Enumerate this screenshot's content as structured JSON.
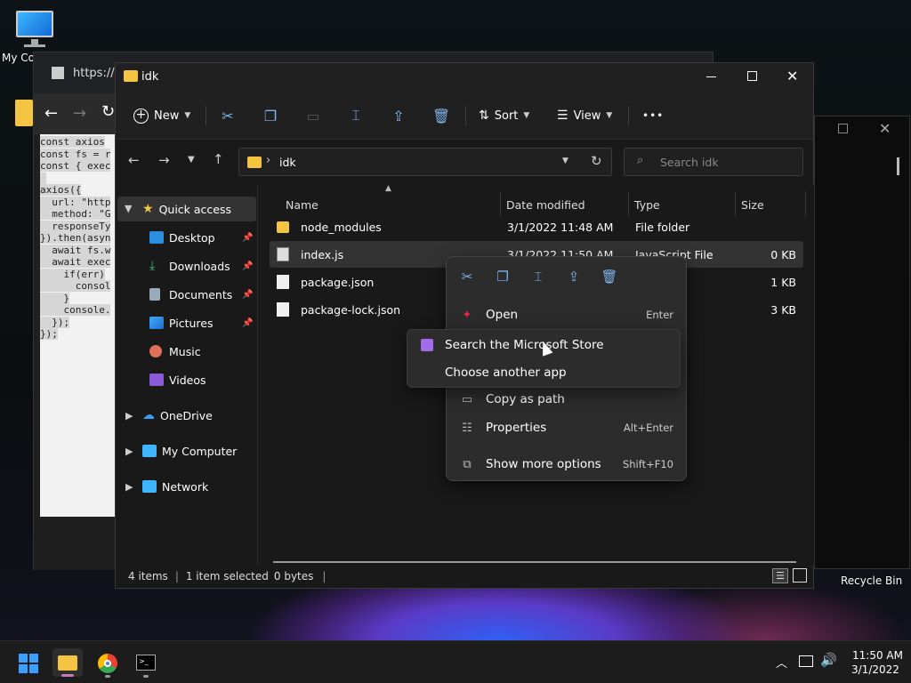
{
  "desktop": {
    "icons": [
      {
        "label": "My Co"
      },
      {
        "label": "Recycle Bin"
      }
    ]
  },
  "browser": {
    "url": "https://pa",
    "code_lines": [
      "const axios",
      "const fs = r",
      "const { exec",
      "",
      "axios({",
      "  url: \"http",
      "  method: \"G",
      "  responseTy",
      "}).then(asyn",
      "  await fs.w",
      "  await exec",
      "    if(err)",
      "      consol",
      "    }",
      "    console.",
      "  });",
      "});"
    ]
  },
  "explorer": {
    "title": "idk",
    "toolbar": {
      "new_label": "New",
      "sort_label": "Sort",
      "view_label": "View",
      "more_label": "•••"
    },
    "address": {
      "separator": "›",
      "folder": "idk"
    },
    "search": {
      "placeholder": "Search idk"
    },
    "nav": {
      "quick_access": "Quick access",
      "items": [
        "Desktop",
        "Downloads",
        "Documents",
        "Pictures",
        "Music",
        "Videos"
      ],
      "onedrive": "OneDrive",
      "my_computer": "My Computer",
      "network": "Network"
    },
    "columns": {
      "name": "Name",
      "date": "Date modified",
      "type": "Type",
      "size": "Size"
    },
    "files": [
      {
        "name": "node_modules",
        "date": "3/1/2022 11:48 AM",
        "type": "File folder",
        "size": ""
      },
      {
        "name": "index.js",
        "date": "3/1/2022 11:50 AM",
        "type": "JavaScript File",
        "size": "0 KB"
      },
      {
        "name": "package.json",
        "date": "",
        "type": "",
        "size": "1 KB"
      },
      {
        "name": "package-lock.json",
        "date": "",
        "type": "",
        "size": "3 KB"
      }
    ],
    "status": {
      "items": "4 items",
      "selected": "1 item selected",
      "bytes": "0 bytes"
    }
  },
  "context_menu": {
    "open": {
      "label": "Open",
      "shortcut": "Enter"
    },
    "copy_path": {
      "label": "Copy as path"
    },
    "properties": {
      "label": "Properties",
      "shortcut": "Alt+Enter"
    },
    "more_options": {
      "label": "Show more options",
      "shortcut": "Shift+F10"
    }
  },
  "open_with_submenu": {
    "store": "Search the Microsoft Store",
    "another": "Choose another app"
  },
  "taskbar": {
    "time": "11:50 AM",
    "date": "3/1/2022"
  },
  "colors": {
    "accent": "#7fb3ea",
    "folder": "#f4c542",
    "selection": "#333333"
  }
}
